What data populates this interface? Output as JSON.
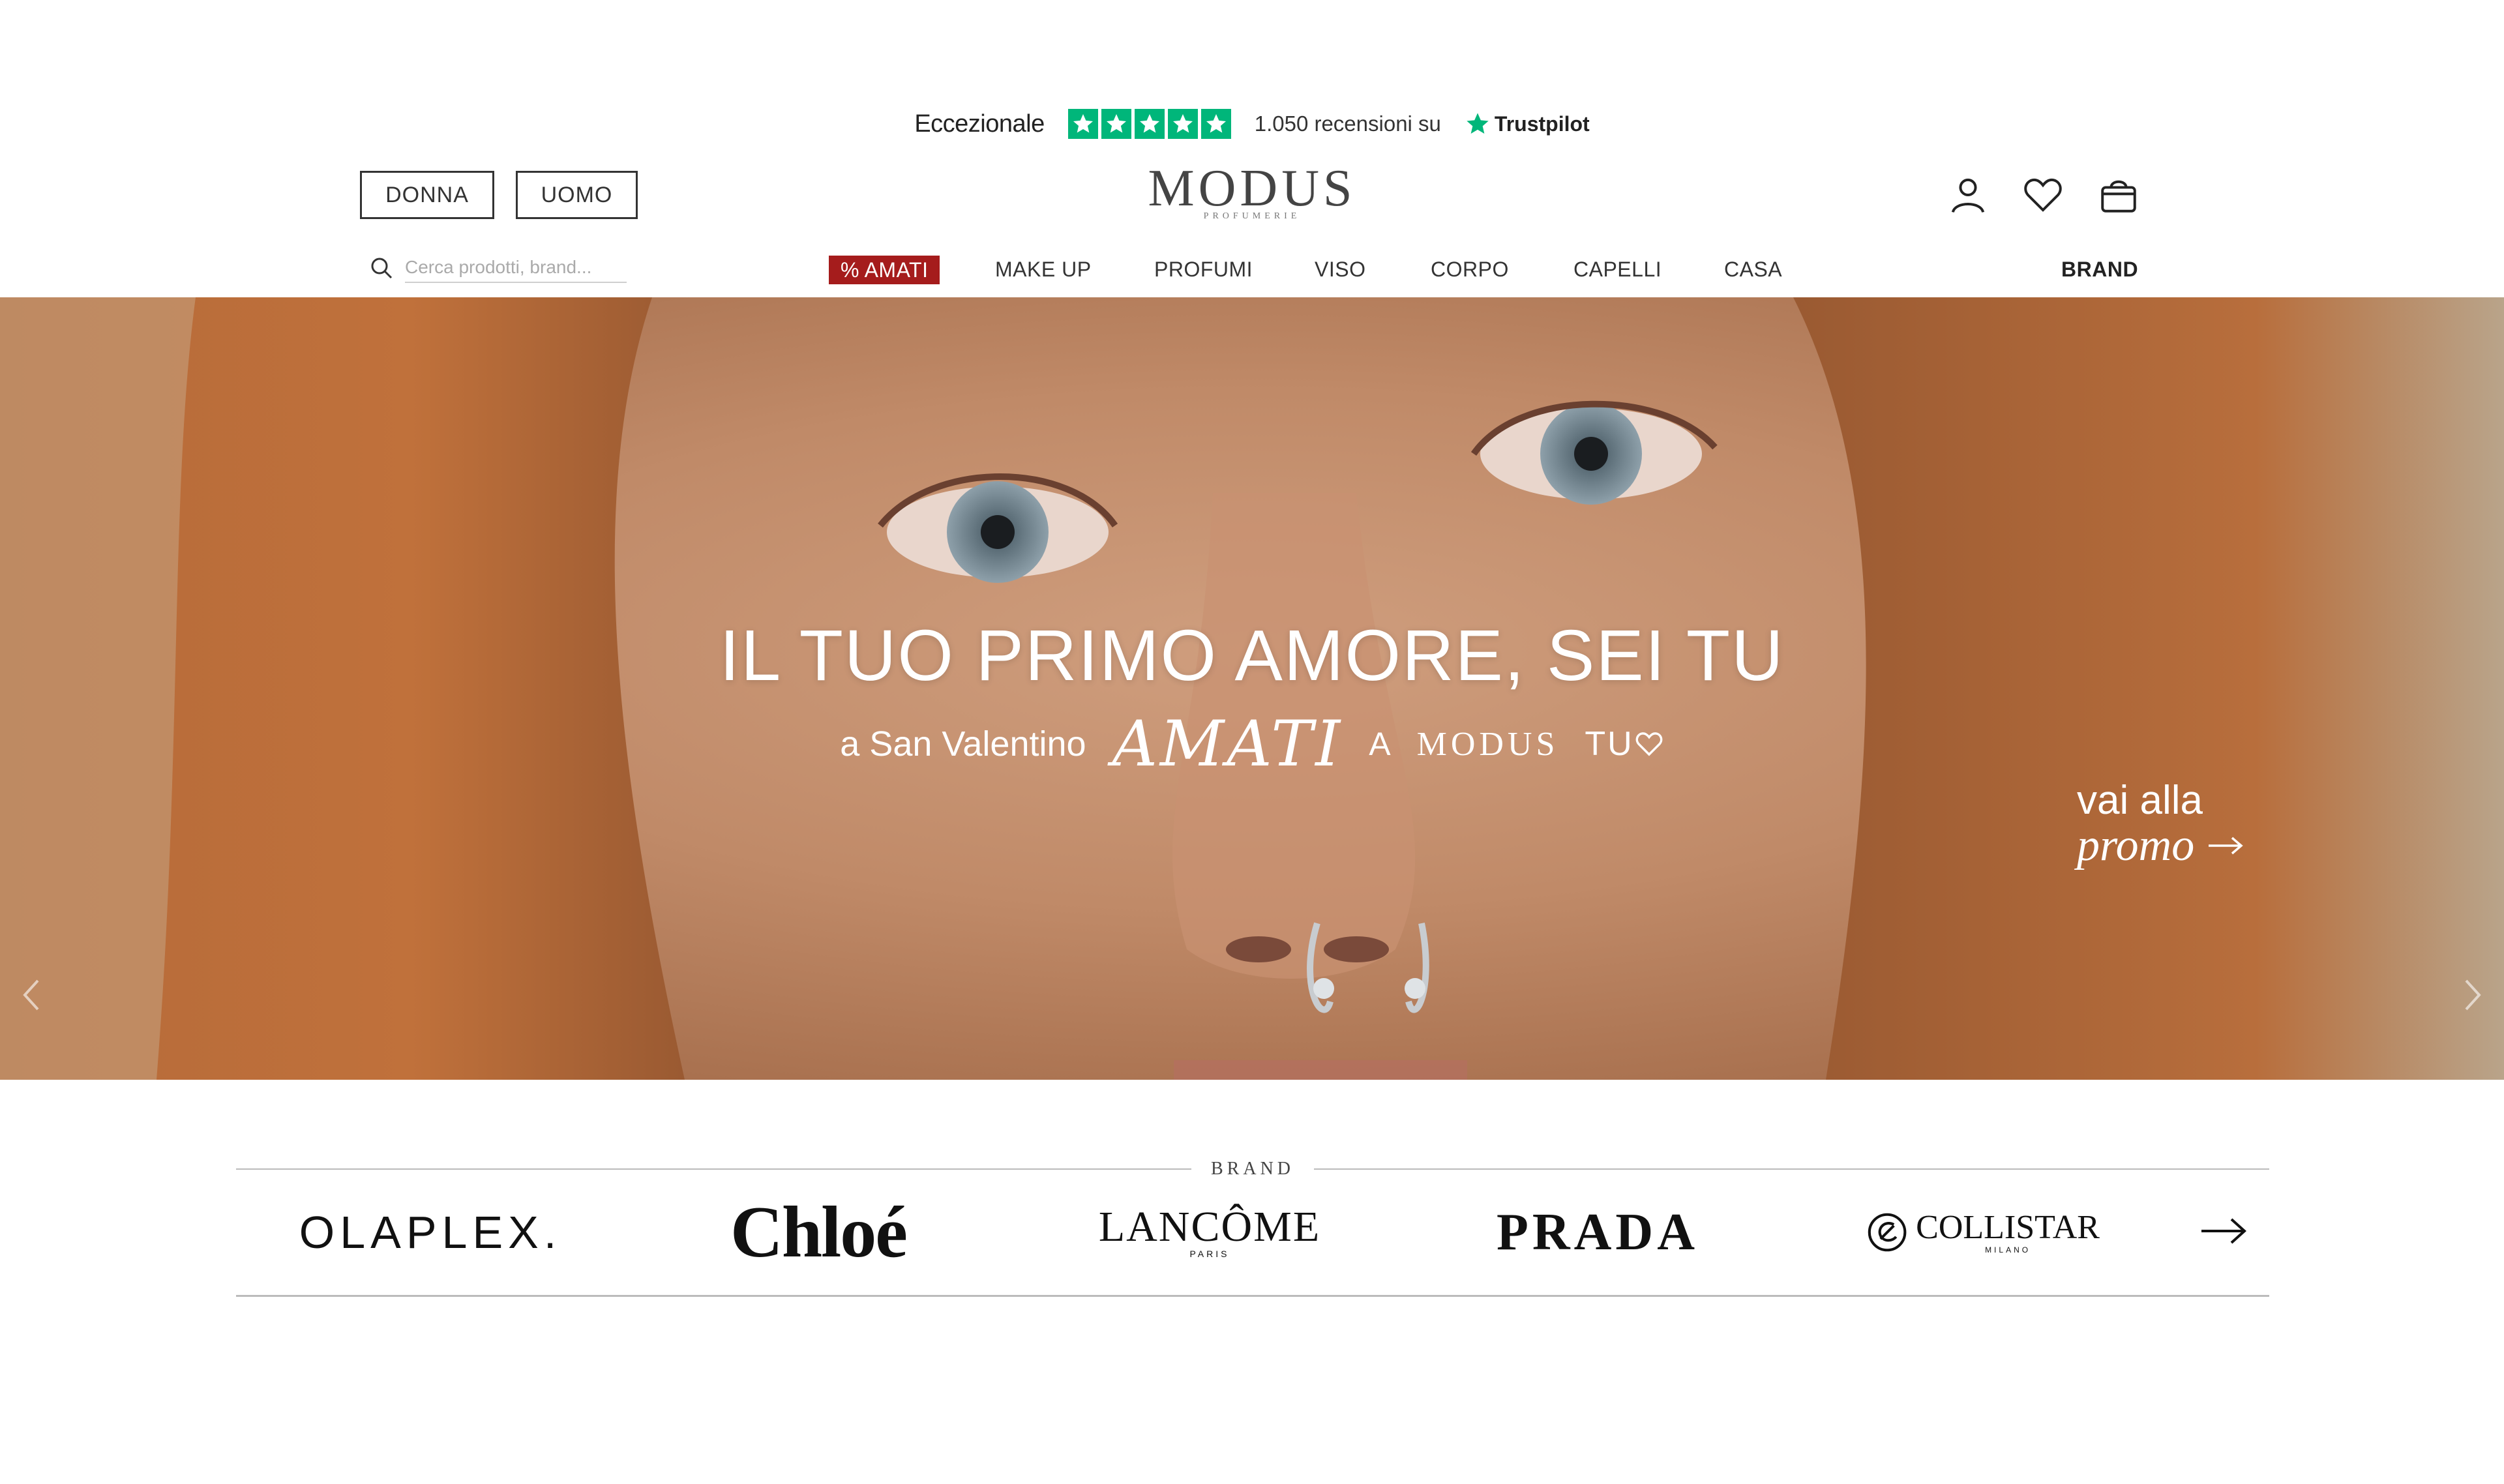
{
  "trustpilot": {
    "rating_label": "Eccezionale",
    "stars": 5,
    "reviews_text": "1.050 recensioni su",
    "brand": "Trustpilot",
    "color": "#00b67a"
  },
  "header": {
    "gender_buttons": [
      "DONNA",
      "UOMO"
    ],
    "logo": {
      "main": "MODUS",
      "sub": "PROFUMERIE"
    },
    "icons": [
      "account-icon",
      "heart-icon",
      "shopping-bag-icon"
    ]
  },
  "search": {
    "placeholder": "Cerca prodotti, brand..."
  },
  "nav": {
    "items": [
      "% AMATI",
      "MAKE UP",
      "PROFUMI",
      "VISO",
      "CORPO",
      "CAPELLI",
      "CASA"
    ],
    "brand": "BRAND",
    "promo_color": "#a51c1c"
  },
  "hero": {
    "title": "IL TUO PRIMO AMORE, SEI TU",
    "subtitle": {
      "prefix": "a San Valentino",
      "amati": "AMATI",
      "a": "A",
      "modus": "MODUS",
      "tuo": "TU"
    },
    "cta": {
      "line1": "vai alla",
      "line2": "promo"
    }
  },
  "brands": {
    "title": "BRAND",
    "logos": [
      "OLAPLEX.",
      "Chloé",
      "LANCÔME",
      "PRADA",
      "COLLISTAR"
    ],
    "lancome_sub": "PARIS",
    "collistar_sub": "MILANO"
  }
}
